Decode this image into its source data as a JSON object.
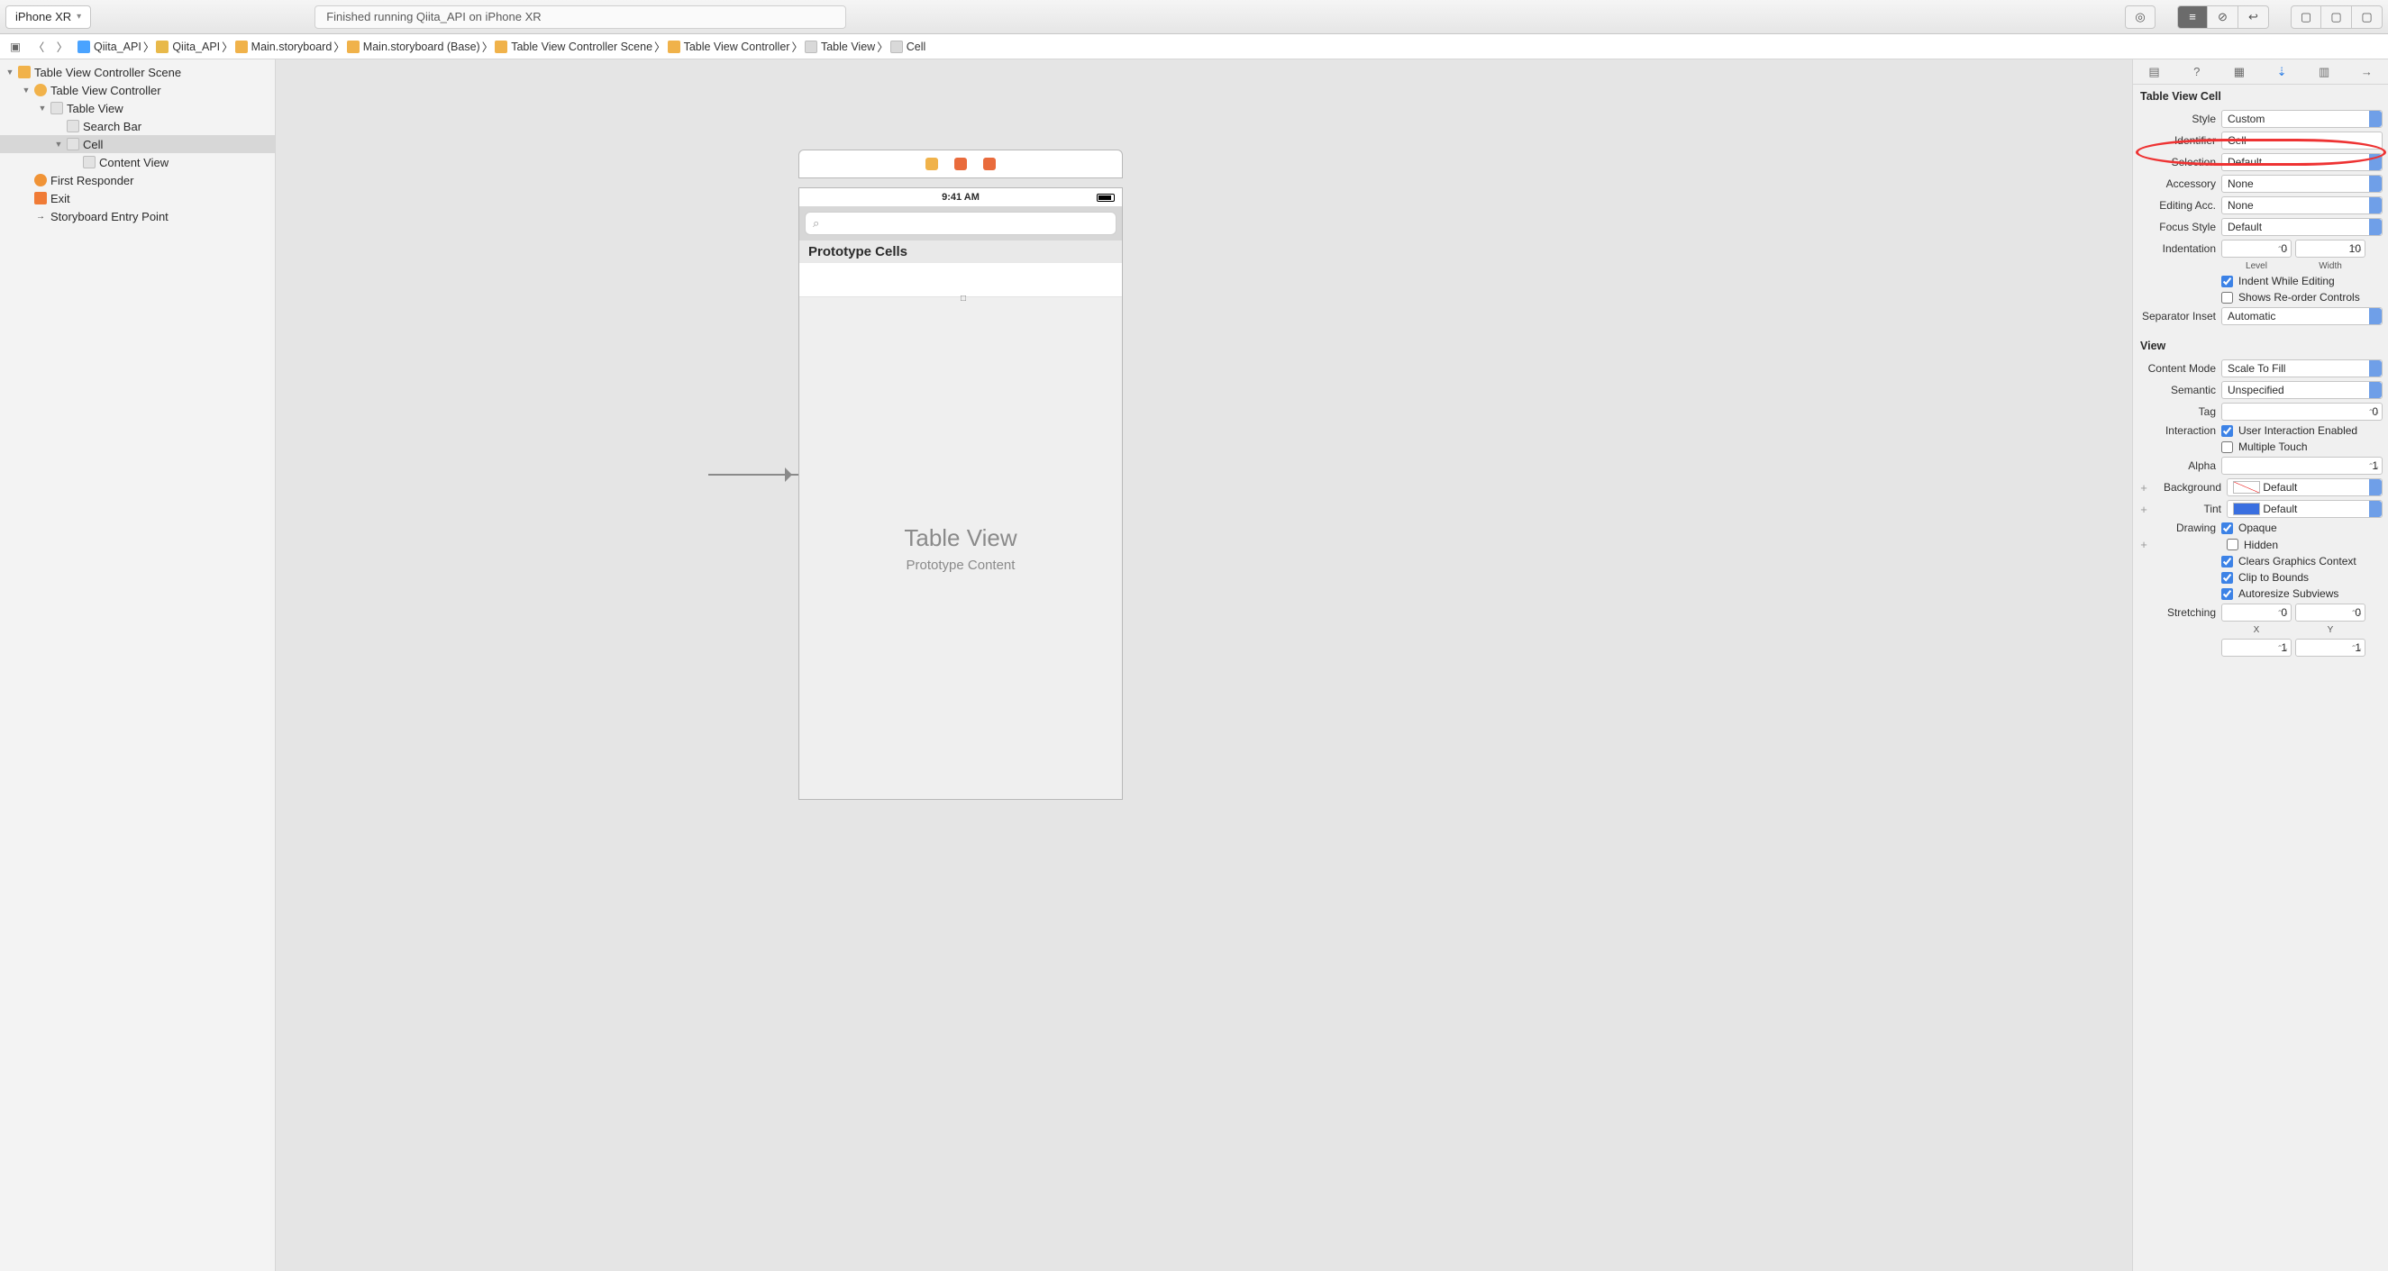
{
  "toolbar": {
    "scheme": "iPhone XR",
    "status": "Finished running Qiita_API on iPhone XR"
  },
  "jumpbar": {
    "items": [
      {
        "icon": "blue",
        "label": "Qiita_API"
      },
      {
        "icon": "folder",
        "label": "Qiita_API"
      },
      {
        "icon": "story",
        "label": "Main.storyboard"
      },
      {
        "icon": "story",
        "label": "Main.storyboard (Base)"
      },
      {
        "icon": "scene",
        "label": "Table View Controller Scene"
      },
      {
        "icon": "scene",
        "label": "Table View Controller"
      },
      {
        "icon": "view",
        "label": "Table View"
      },
      {
        "icon": "view",
        "label": "Cell"
      }
    ]
  },
  "navigator": {
    "rows": [
      {
        "indent": 0,
        "disc": "▼",
        "icon": "scene",
        "label": "Table View Controller Scene"
      },
      {
        "indent": 1,
        "disc": "▼",
        "icon": "vc",
        "label": "Table View Controller"
      },
      {
        "indent": 2,
        "disc": "▼",
        "icon": "view",
        "label": "Table View"
      },
      {
        "indent": 3,
        "disc": "",
        "icon": "view",
        "label": "Search Bar"
      },
      {
        "indent": 3,
        "disc": "▼",
        "icon": "view",
        "label": "Cell",
        "sel": true
      },
      {
        "indent": 4,
        "disc": "",
        "icon": "view",
        "label": "Content View"
      },
      {
        "indent": 1,
        "disc": "",
        "icon": "fr",
        "label": "First Responder"
      },
      {
        "indent": 1,
        "disc": "",
        "icon": "exit",
        "label": "Exit"
      },
      {
        "indent": 1,
        "disc": "",
        "icon": "arrow",
        "label": "Storyboard Entry Point"
      }
    ]
  },
  "canvas": {
    "status_time": "9:41 AM",
    "proto_header": "Prototype Cells",
    "placeholder_big": "Table View",
    "placeholder_sub": "Prototype Content"
  },
  "inspector": {
    "section1": "Table View Cell",
    "style": {
      "label": "Style",
      "value": "Custom"
    },
    "identifier": {
      "label": "Identifier",
      "value": "Cell"
    },
    "selection": {
      "label": "Selection",
      "value": "Default"
    },
    "accessory": {
      "label": "Accessory",
      "value": "None"
    },
    "editingAcc": {
      "label": "Editing Acc.",
      "value": "None"
    },
    "focusStyle": {
      "label": "Focus Style",
      "value": "Default"
    },
    "indentation": {
      "label": "Indentation",
      "level": "0",
      "width": "10",
      "level_lbl": "Level",
      "width_lbl": "Width"
    },
    "indentWhile": {
      "label": "Indent While Editing",
      "checked": true
    },
    "showsReorder": {
      "label": "Shows Re-order Controls",
      "checked": false
    },
    "separator": {
      "label": "Separator Inset",
      "value": "Automatic"
    },
    "section2": "View",
    "contentMode": {
      "label": "Content Mode",
      "value": "Scale To Fill"
    },
    "semantic": {
      "label": "Semantic",
      "value": "Unspecified"
    },
    "tag": {
      "label": "Tag",
      "value": "0"
    },
    "interaction": {
      "label": "Interaction",
      "a": "User Interaction Enabled",
      "a_chk": true,
      "b": "Multiple Touch",
      "b_chk": false
    },
    "alpha": {
      "label": "Alpha",
      "value": "1"
    },
    "background": {
      "label": "Background",
      "value": "Default"
    },
    "tint": {
      "label": "Tint",
      "value": "Default"
    },
    "drawing": {
      "label": "Drawing",
      "opaque": {
        "label": "Opaque",
        "chk": true
      },
      "hidden": {
        "label": "Hidden",
        "chk": false
      },
      "clears": {
        "label": "Clears Graphics Context",
        "chk": true
      },
      "clip": {
        "label": "Clip to Bounds",
        "chk": true
      },
      "auto": {
        "label": "Autoresize Subviews",
        "chk": true
      }
    },
    "stretching": {
      "label": "Stretching",
      "x": "0",
      "y": "0",
      "x_lbl": "X",
      "y_lbl": "Y",
      "w": "1",
      "h": "1"
    }
  }
}
